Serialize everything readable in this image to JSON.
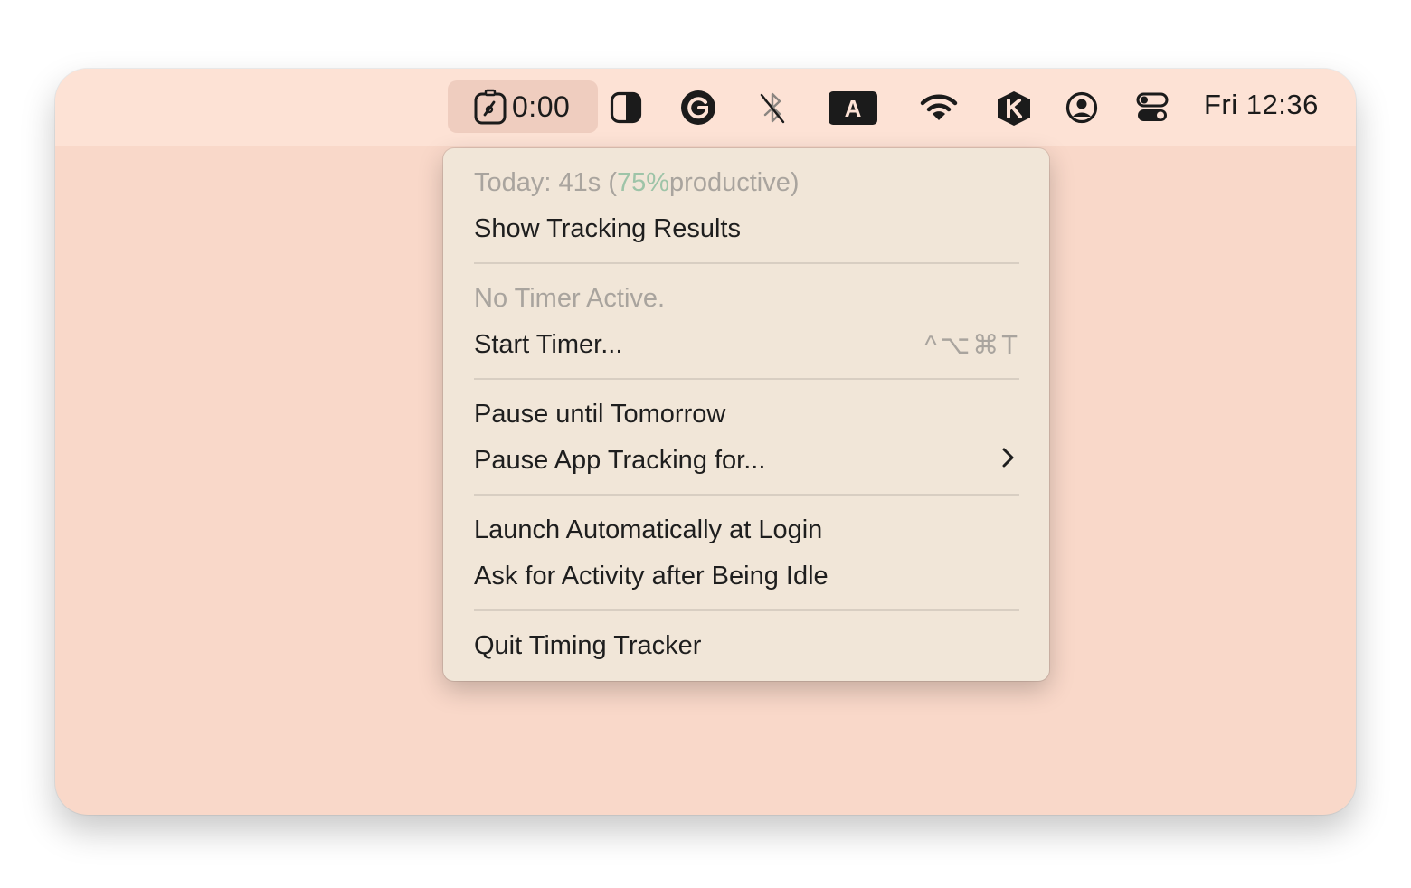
{
  "menubar": {
    "timer": {
      "icon": "timer-app-icon",
      "label": "0:00"
    },
    "icons": [
      "contrast-icon",
      "grammarly-icon",
      "bluetooth-off-icon",
      "keyboard-input-a-icon",
      "wifi-icon",
      "k-app-icon",
      "user-account-icon",
      "control-center-icon"
    ],
    "clock": "Fri 12:36"
  },
  "menu": {
    "summary": {
      "prefix": "Today: 41s (",
      "percent": "75%",
      "suffix": " productive)"
    },
    "show_results": "Show Tracking Results",
    "no_timer": "No Timer Active.",
    "start_timer": "Start Timer...",
    "start_timer_shortcut": "^⌥⌘T",
    "pause_tomorrow": "Pause until Tomorrow",
    "pause_app_tracking": "Pause App Tracking for...",
    "launch_login": "Launch Automatically at Login",
    "ask_idle": "Ask for Activity after Being Idle",
    "quit": "Quit Timing Tracker"
  },
  "colors": {
    "window_bg": "#f9d8c9",
    "menubar_bg": "#fde2d5",
    "menu_bg": "#f1e6d8",
    "accent_green": "#9ec4a8",
    "disabled_text": "#a9a49e"
  }
}
